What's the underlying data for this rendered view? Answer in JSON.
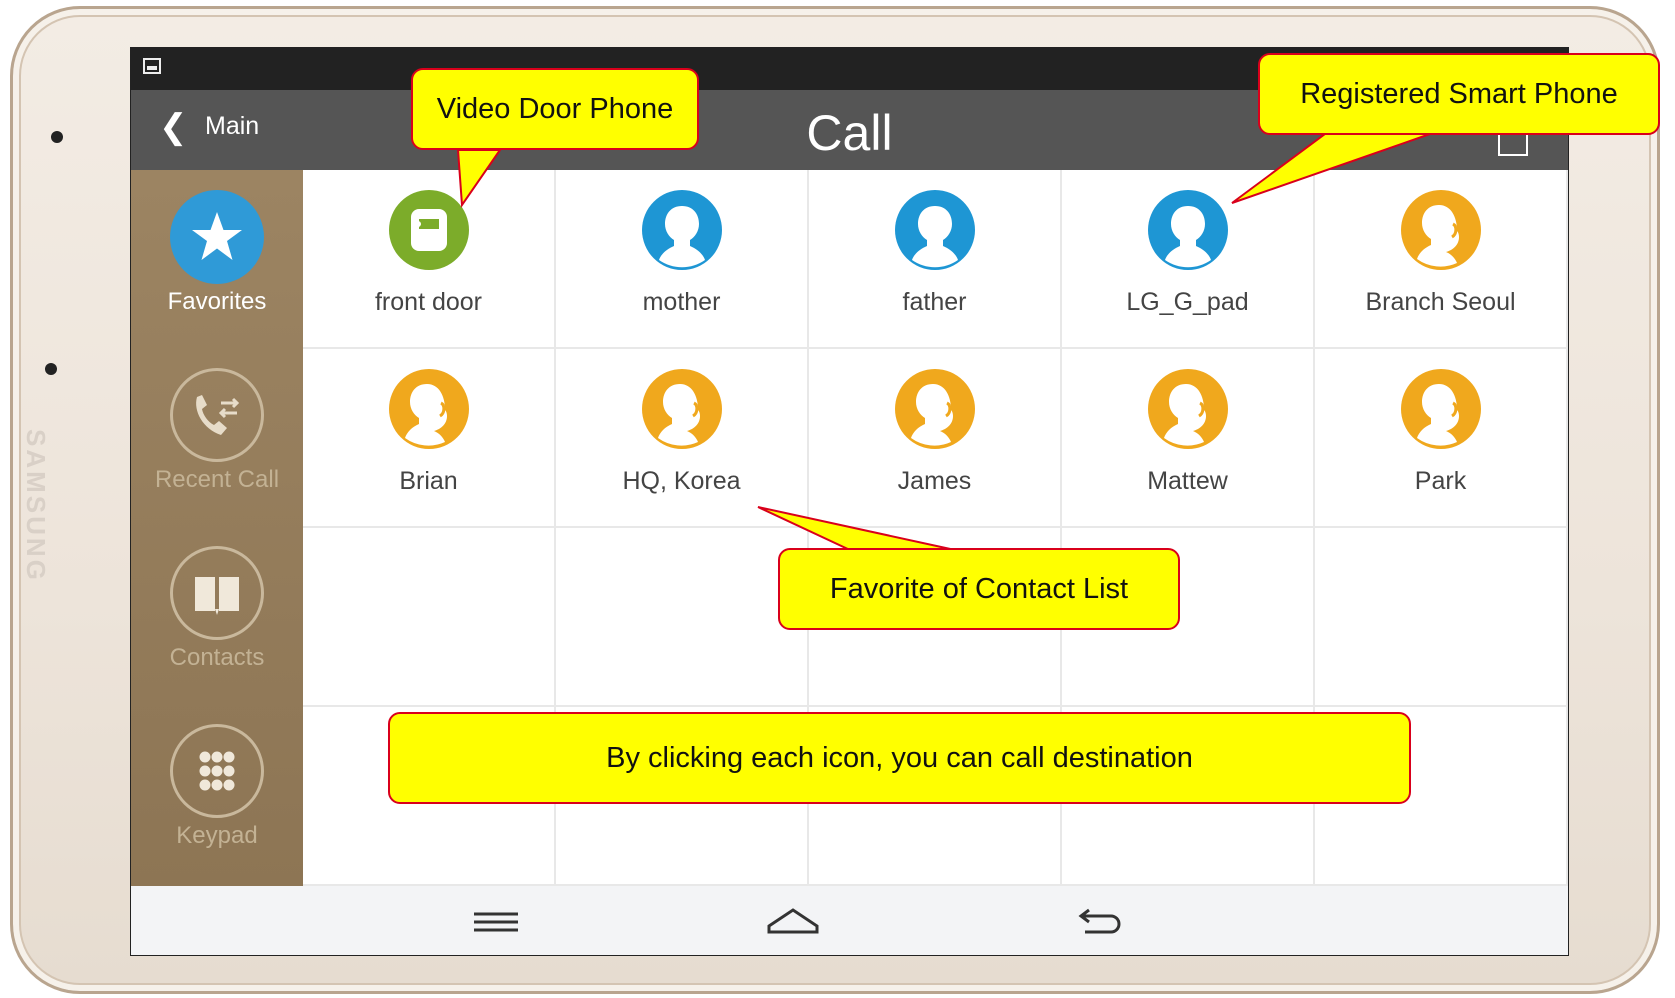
{
  "device": {
    "brand": "SAMSUNG"
  },
  "header": {
    "back_label": "Main",
    "title": "Call"
  },
  "sidebar": {
    "items": [
      {
        "label": "Favorites",
        "icon": "star-icon",
        "active": true
      },
      {
        "label": "Recent Call",
        "icon": "phone-arrows-icon",
        "active": false
      },
      {
        "label": "Contacts",
        "icon": "book-icon",
        "active": false
      },
      {
        "label": "Keypad",
        "icon": "keypad-icon",
        "active": false
      }
    ]
  },
  "favorites": [
    {
      "label": "front door",
      "type": "door-phone"
    },
    {
      "label": "mother",
      "type": "smart-phone"
    },
    {
      "label": "father",
      "type": "smart-phone"
    },
    {
      "label": "LG_G_pad",
      "type": "smart-phone"
    },
    {
      "label": "Branch Seoul",
      "type": "contact"
    },
    {
      "label": "Brian",
      "type": "contact"
    },
    {
      "label": "HQ, Korea",
      "type": "contact"
    },
    {
      "label": "James",
      "type": "contact"
    },
    {
      "label": "Mattew",
      "type": "contact"
    },
    {
      "label": "Park",
      "type": "contact"
    }
  ],
  "navbar": {
    "icons": [
      "menu-icon",
      "home-icon",
      "back-icon"
    ]
  },
  "callouts": {
    "video_door_phone": "Video Door Phone",
    "registered_smart_phone": "Registered Smart Phone",
    "favorite_contact_list": "Favorite of Contact List",
    "click_to_call": "By clicking each icon, you can call destination"
  },
  "colors": {
    "door_phone": "#7cac2a",
    "smart_phone": "#1e96d4",
    "contact": "#f0a81d",
    "callout_fill": "#ffff00",
    "callout_border": "#d9001b"
  }
}
